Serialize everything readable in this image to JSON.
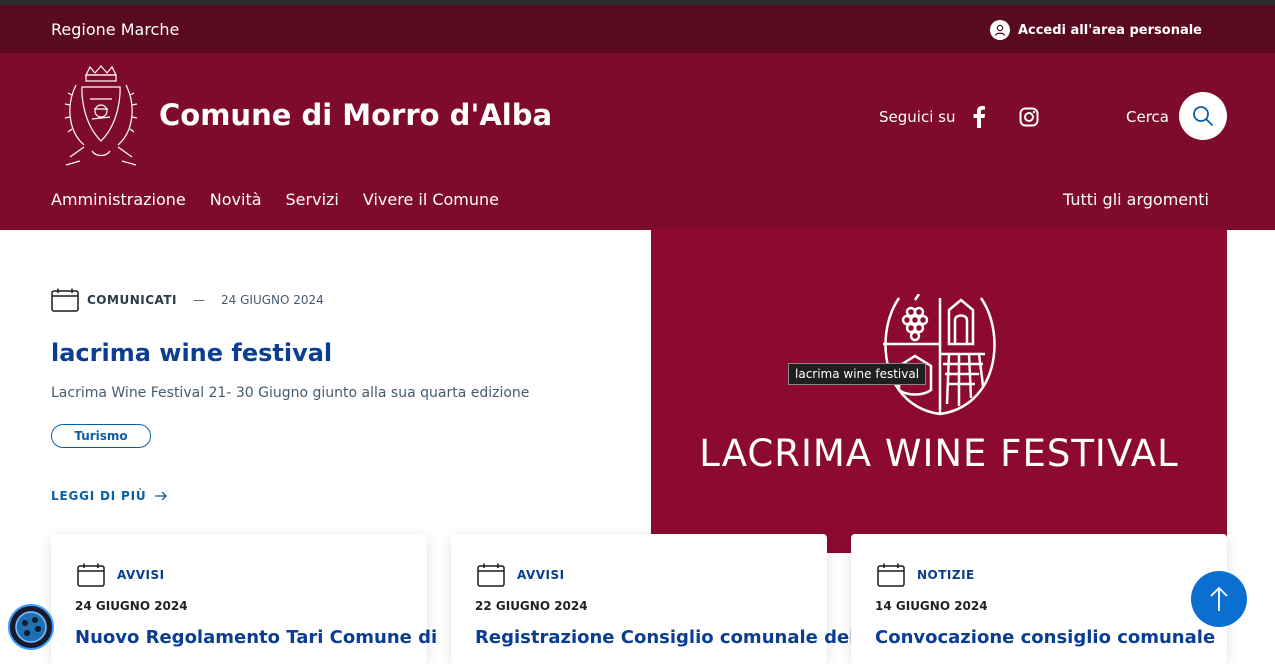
{
  "header_slim": {
    "region": "Regione Marche",
    "login_label": "Accedi all'area personale"
  },
  "header_center": {
    "brand": "Comune di Morro d'Alba",
    "follow_label": "Seguici su",
    "search_label": "Cerca"
  },
  "nav": {
    "items": [
      "Amministrazione",
      "Novità",
      "Servizi",
      "Vivere il Comune"
    ],
    "topics": "Tutti gli argomenti"
  },
  "hero": {
    "category": "COMUNICATI",
    "dash": "—",
    "date": "24 GIUGNO 2024",
    "title": "lacrima wine festival",
    "description": "Lacrima Wine Festival 21- 30 Giugno giunto alla sua quarta edizione",
    "chip": "Turismo",
    "read_more": "LEGGI DI PIÙ",
    "image_text": "LACRIMA WINE FESTIVAL",
    "tooltip": "lacrima wine festival"
  },
  "cards": [
    {
      "category": "AVVISI",
      "date": "24 GIUGNO 2024",
      "title": "Nuovo Regolamento Tari Comune di"
    },
    {
      "category": "AVVISI",
      "date": "22 GIUGNO 2024",
      "title": "Registrazione Consiglio comunale del"
    },
    {
      "category": "NOTIZIE",
      "date": "14 GIUGNO 2024",
      "title": "Convocazione consiglio comunale"
    }
  ],
  "colors": {
    "slim_header": "#5a0a20",
    "center_header": "#7f0b2c",
    "hero_image": "#8c0a30",
    "link_blue": "#0b3d91",
    "button_blue": "#0b6fd1"
  },
  "icons": {
    "login": "user-icon",
    "facebook": "facebook-icon",
    "instagram": "instagram-icon",
    "search": "search-icon",
    "calendar": "calendar-icon",
    "arrow": "arrow-right-icon",
    "scroll_top": "arrow-up-icon",
    "accessibility": "accessibility-icon"
  }
}
